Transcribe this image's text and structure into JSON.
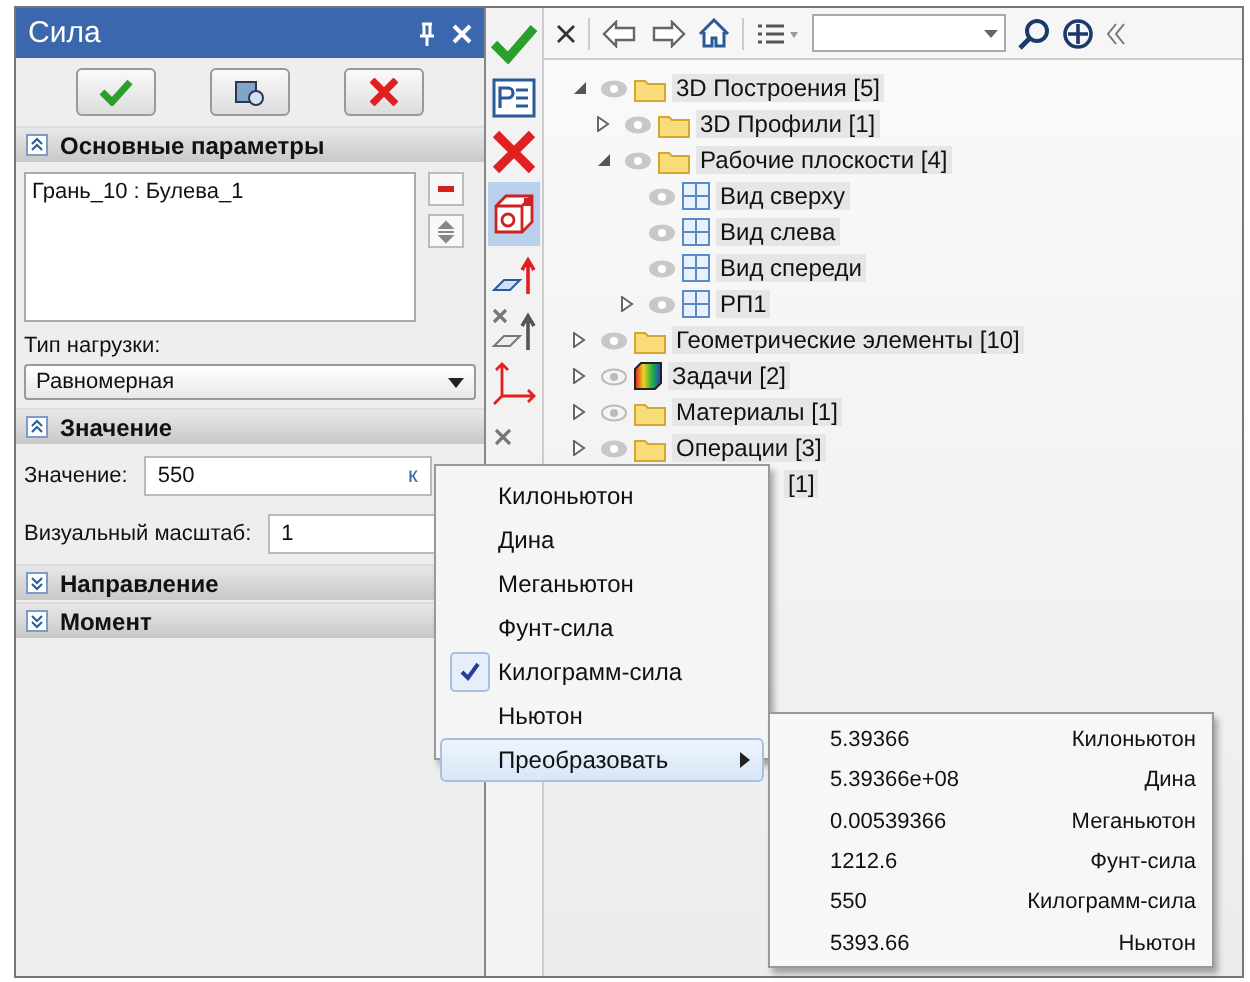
{
  "panel": {
    "title": "Сила",
    "buttons": [
      {
        "kind": "ok"
      },
      {
        "kind": "preview"
      },
      {
        "kind": "cancel"
      }
    ],
    "sections": [
      {
        "kind": "selection",
        "title": "Основные параметры",
        "expanded": true,
        "items": [
          "Грань_10 : Булева_1"
        ],
        "load_type_label": "Тип нагрузки:",
        "load_type": "Равномерная"
      },
      {
        "kind": "value",
        "title": "Значение",
        "expanded": true,
        "fields": [
          {
            "label": "Значение:",
            "value": "550",
            "unit": "к"
          },
          {
            "label": "Визуальный масштаб:",
            "value": "1"
          }
        ]
      },
      {
        "title": "Направление",
        "expanded": false
      },
      {
        "title": "Момент",
        "expanded": false
      }
    ]
  },
  "tools": [
    {
      "kind": "ok",
      "selected": false
    },
    {
      "kind": "params",
      "selected": false
    },
    {
      "kind": "cancel",
      "selected": false
    },
    {
      "kind": "cube",
      "selected": true
    },
    {
      "kind": "plane-arrow",
      "selected": false
    },
    {
      "kind": "cross-plane",
      "selected": false
    },
    {
      "kind": "axes",
      "selected": false
    },
    {
      "kind": "cross",
      "selected": false
    }
  ],
  "tree": [
    {
      "label": "3D Построения [5]",
      "kind": "folder",
      "visible": true,
      "expanded": true,
      "children": [
        {
          "label": "3D Профили [1]",
          "kind": "folder",
          "visible": true,
          "expanded": false
        },
        {
          "label": "Рабочие плоскости [4]",
          "kind": "folder",
          "visible": true,
          "expanded": true,
          "children": [
            {
              "label": "Вид сверху",
              "kind": "plane",
              "visible": true
            },
            {
              "label": "Вид слева",
              "kind": "plane",
              "visible": true
            },
            {
              "label": "Вид спереди",
              "kind": "plane",
              "visible": true
            },
            {
              "label": "РП1",
              "kind": "plane",
              "visible": true,
              "expanded": false
            }
          ]
        }
      ]
    },
    {
      "label": "Геометрические элементы [10]",
      "kind": "folder",
      "visible": true,
      "expanded": false
    },
    {
      "label": "Задачи [2]",
      "kind": "task",
      "visible": false,
      "expanded": false
    },
    {
      "label": "Материалы [1]",
      "kind": "folder",
      "visible": false,
      "expanded": false
    },
    {
      "label": "Операции [3]",
      "kind": "folder",
      "visible": true,
      "expanded": false
    },
    {
      "label": "[1]",
      "kind": "covered"
    }
  ],
  "menu": {
    "items": [
      {
        "kind": "unit",
        "label": "Килоньютон",
        "checked": false,
        "selected": false
      },
      {
        "kind": "unit",
        "label": "Дина",
        "checked": false,
        "selected": false
      },
      {
        "kind": "unit",
        "label": "Меганьютон",
        "checked": false,
        "selected": false
      },
      {
        "kind": "unit",
        "label": "Фунт-сила",
        "checked": false,
        "selected": false
      },
      {
        "kind": "unit",
        "label": "Килограмм-сила",
        "checked": true,
        "selected": false
      },
      {
        "kind": "unit",
        "label": "Ньютон",
        "checked": false,
        "selected": false
      },
      {
        "kind": "submenu",
        "label": "Преобразовать",
        "checked": false,
        "selected": true
      }
    ]
  },
  "submenu": {
    "rows": [
      {
        "value": "5.39366",
        "unit": "Килоньютон"
      },
      {
        "value": "5.39366e+08",
        "unit": "Дина"
      },
      {
        "value": "0.00539366",
        "unit": "Меганьютон"
      },
      {
        "value": "1212.6",
        "unit": "Фунт-сила"
      },
      {
        "value": "550",
        "unit": "Килограмм-сила"
      },
      {
        "value": "5393.66",
        "unit": "Ньютон"
      }
    ]
  }
}
